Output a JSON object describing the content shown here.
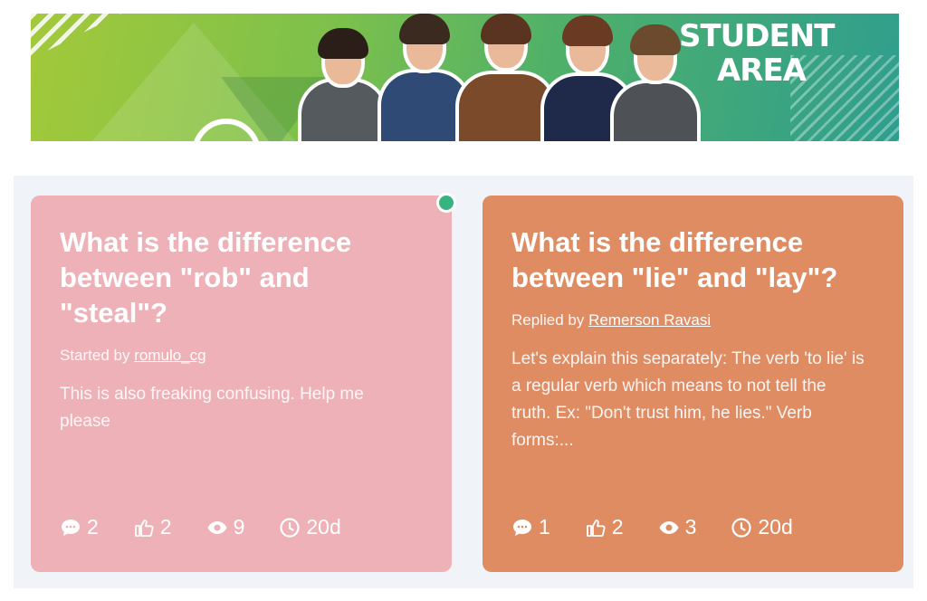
{
  "banner": {
    "title_line1": "STUDENT",
    "title_line2": "AREA"
  },
  "cards": [
    {
      "title": "What is the difference between \"rob\" and \"steal\"?",
      "meta_prefix": "Started by",
      "author": "romulo_cg",
      "excerpt": "This is also freaking confusing. Help me please",
      "comments": "2",
      "likes": "2",
      "views": "9",
      "age": "20d",
      "color": "#eeb1b8"
    },
    {
      "title": "What is the difference between \"lie\" and \"lay\"?",
      "meta_prefix": "Replied by",
      "author": "Remerson Ravasi",
      "excerpt": "Let's explain this separately: The verb 'to lie' is a regular verb which means to not tell the truth. Ex: \"Don't trust him, he lies.\" Verb forms:...",
      "comments": "1",
      "likes": "2",
      "views": "3",
      "age": "20d",
      "color": "#e08c63"
    }
  ],
  "status_color": "#36b37e"
}
